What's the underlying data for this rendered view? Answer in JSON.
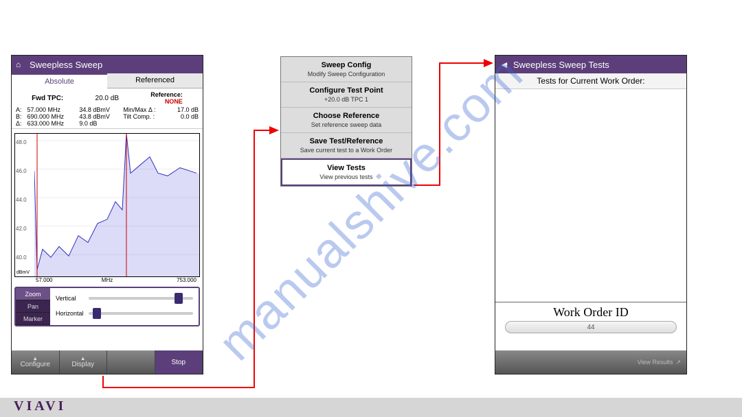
{
  "watermark": "manualshive.com",
  "footer_brand": "VIAVI",
  "screen1": {
    "title": "Sweepless Sweep",
    "tabs": {
      "absolute": "Absolute",
      "referenced": "Referenced"
    },
    "fwd_tpc_label": "Fwd TPC:",
    "fwd_tpc_val": "20.0 dB",
    "reference_label": "Reference:",
    "reference_val": "NONE",
    "rows": {
      "a_lbl": "A:",
      "a_f": "57.000 MHz",
      "a_l": "34.8 dBmV",
      "b_lbl": "B:",
      "b_f": "690.000 MHz",
      "b_l": "43.8 dBmV",
      "d_lbl": "Δ:",
      "d_f": "633.000 MHz",
      "d_l": "9.0 dB",
      "mm_lbl": "Min/Max Δ :",
      "mm_v": "17.0 dB",
      "tc_lbl": "Tilt Comp. :",
      "tc_v": "0.0 dB"
    },
    "axes": {
      "y": [
        "48.0",
        "46.0",
        "44.0",
        "42.0",
        "40.0"
      ],
      "dbmv": "dBmV",
      "xmin": "57.000",
      "xmid": "MHz",
      "xmax": "753.000"
    },
    "control": {
      "zoom": "Zoom",
      "pan": "Pan",
      "marker": "Marker",
      "vertical": "Vertical",
      "horizontal": "Horizontal"
    },
    "bottom": {
      "configure": "Configure",
      "display": "Display",
      "stop": "Stop"
    }
  },
  "popup": [
    {
      "t": "Sweep Config",
      "s": "Modify Sweep Configuration"
    },
    {
      "t": "Configure Test Point",
      "s": "+20.0 dB TPC 1"
    },
    {
      "t": "Choose Reference",
      "s": "Set reference sweep data"
    },
    {
      "t": "Save Test/Reference",
      "s": "Save current test to a Work Order"
    },
    {
      "t": "View Tests",
      "s": "View previous tests"
    }
  ],
  "screen2": {
    "title": "Sweepless Sweep Tests",
    "subtitle": "Tests for Current Work Order:",
    "woid_label": "Work Order ID",
    "woid_val": "44",
    "view_results": "View Results"
  },
  "chart_data": {
    "type": "line",
    "title": "Sweepless Sweep trace",
    "xlabel": "MHz",
    "ylabel": "dBmV",
    "xlim": [
      57,
      753
    ],
    "ylim": [
      40,
      48
    ],
    "x": [
      57,
      80,
      100,
      130,
      160,
      200,
      240,
      280,
      320,
      360,
      400,
      440,
      480,
      520,
      560,
      600,
      640,
      680,
      720,
      753
    ],
    "values": [
      46.0,
      40.8,
      41.5,
      41.0,
      41.8,
      41.2,
      42.5,
      42.0,
      43.3,
      43.6,
      44.8,
      44.2,
      48.5,
      46.0,
      46.6,
      47.2,
      46.0,
      45.8,
      46.4,
      46.0
    ],
    "spikes_x": [
      70,
      440
    ]
  }
}
